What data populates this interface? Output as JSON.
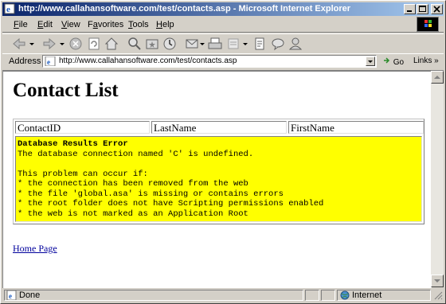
{
  "window": {
    "title": "http://www.callahansoftware.com/test/contacts.asp - Microsoft Internet Explorer"
  },
  "menu": [
    {
      "key": "F",
      "rest": "ile"
    },
    {
      "key": "E",
      "rest": "dit"
    },
    {
      "key": "V",
      "rest": "iew"
    },
    {
      "key": "",
      "pre": "F",
      "key2": "a",
      "rest": "vorites"
    },
    {
      "key": "T",
      "rest": "ools"
    },
    {
      "key": "H",
      "rest": "elp"
    }
  ],
  "address": {
    "label": "Address",
    "url": "http://www.callahansoftware.com/test/contacts.asp",
    "go": "Go",
    "links": "Links »"
  },
  "page": {
    "heading": "Contact List",
    "columns": [
      "ContactID",
      "LastName",
      "FirstName"
    ],
    "error": {
      "title": "Database Results Error",
      "lines": [
        "The database connection named 'C' is undefined.",
        "",
        "This problem can occur if:",
        "* the connection has been removed from the web",
        "* the file 'global.asa' is missing or contains errors",
        "* the root folder does not have Scripting permissions enabled",
        "* the web is not marked as an Application Root"
      ]
    },
    "link": "Home Page"
  },
  "status": {
    "text": "Done",
    "zone": "Internet"
  }
}
